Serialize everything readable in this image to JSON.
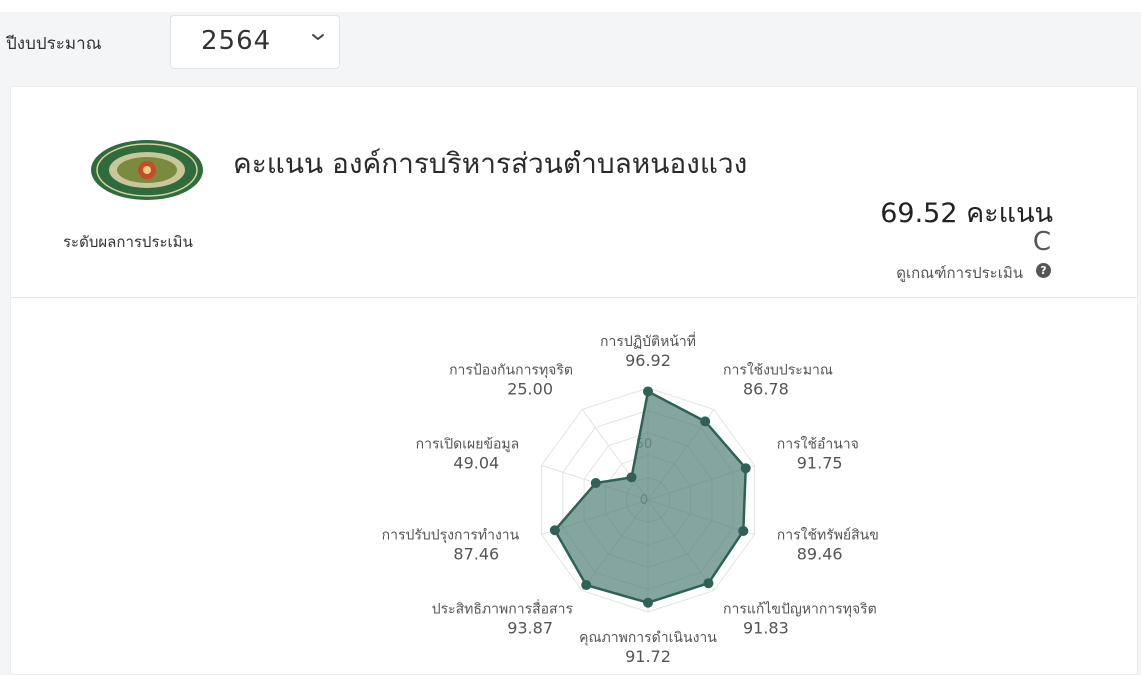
{
  "budget_year": {
    "label": "ปีงบประมาณ",
    "value": "2564"
  },
  "organization": {
    "title": "คะแนน องค์การบริหารส่วนตำบลหนองแวง"
  },
  "score": {
    "text": "69.52 คะแนน"
  },
  "assessment": {
    "level_label": "ระดับผลการประเมิน",
    "grade": "C",
    "criteria_link": "ดูเกณฑ์การประเมิน"
  },
  "chart_data": {
    "type": "radar",
    "range": [
      0,
      100
    ],
    "ticks": [
      "0",
      "50"
    ],
    "fill_color": "#4a7c72",
    "categories": [
      "การปฏิบัติหน้าที่",
      "การใช้งบประมาณ",
      "การใช้อำนาจ",
      "การใช้ทรัพย์สินข",
      "การแก้ไขปัญหาการทุจริต",
      "คุณภาพการดำเนินงาน",
      "ประสิทธิภาพการสื่อสาร",
      "การปรับปรุงการทำงาน",
      "การเปิดเผยข้อมูล",
      "การป้องกันการทุจริต"
    ],
    "values": [
      96.92,
      86.78,
      91.75,
      89.46,
      91.83,
      91.72,
      93.87,
      87.46,
      49.04,
      25.0
    ],
    "value_labels": [
      "96.92",
      "86.78",
      "91.75",
      "89.46",
      "91.83",
      "91.72",
      "93.87",
      "87.46",
      "49.04",
      "25.00"
    ]
  }
}
